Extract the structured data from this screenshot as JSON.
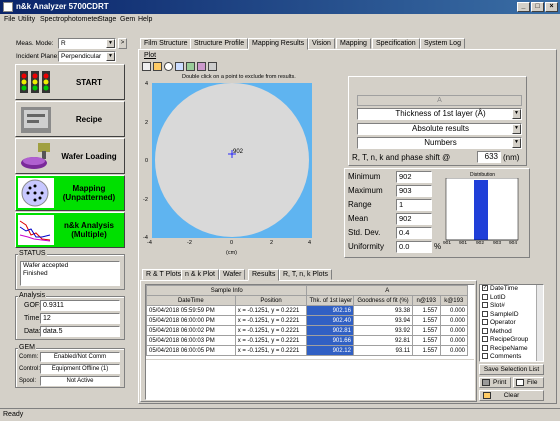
{
  "window": {
    "title": "n&k Analyzer 5700CDRT"
  },
  "menu": [
    "File",
    "Utility",
    "Spectrophotometer",
    "Stage",
    "Gem",
    "Help"
  ],
  "left": {
    "meas_mode_label": "Meas. Mode:",
    "meas_mode_value": "R",
    "incident_label": "Incident Plane:",
    "incident_value": "Perpendicular",
    "buttons": {
      "start": "START",
      "recipe": "Recipe",
      "wafer": "Wafer Loading",
      "mapping": "Mapping (Unpatterned)",
      "nk": "n&k Analysis (Multiple)"
    },
    "status_title": "STATUS",
    "status_lines": [
      "Wafer accepted",
      "Finished"
    ],
    "analysis_title": "Analysis",
    "gof_label": "GOF:",
    "gof_value": "0.9311",
    "time_label": "Time:",
    "time_value": "12",
    "data_label": "Data:",
    "data_value": "data.5",
    "gem_title": "GEM",
    "comm_label": "Comm:",
    "comm_value": "Enabled/Not Comm",
    "control_label": "Control:",
    "control_value": "Equipment Offline (1)",
    "spool_label": "Spool:",
    "spool_value": "Not Active"
  },
  "tabs": [
    "Film Structure",
    "Structure Profile",
    "Mapping Results",
    "Vision",
    "Mapping",
    "Specification",
    "System Log"
  ],
  "active_tab": "Mapping Results",
  "plot_label": "Plot",
  "map": {
    "hint": "Double click on a point to exclude from results.",
    "point_label": "902",
    "x_unit": "(cm)",
    "ticks": [
      "-4",
      "-2",
      "0",
      "2",
      "4"
    ],
    "yticks": [
      "4",
      "2",
      "0",
      "-2",
      "-4"
    ],
    "wafer_color": "#d9d9d9",
    "bg": "#5fb4f0"
  },
  "right": {
    "dd_a": "A",
    "dd_layer": "Thickness of 1st layer (Å)",
    "dd_results": "Absolute results",
    "dd_numbers": "Numbers",
    "phase_label": "R, T, n, k and phase shift @",
    "phase_value": "633",
    "phase_unit": "(nm)"
  },
  "stats": [
    {
      "label": "Minimum",
      "value": "902"
    },
    {
      "label": "Maximum",
      "value": "903"
    },
    {
      "label": "Range",
      "value": "1"
    },
    {
      "label": "Mean",
      "value": "902"
    },
    {
      "label": "Std. Dev.",
      "value": "0.4"
    },
    {
      "label": "Uniformity",
      "value": "0.0",
      "unit": "%"
    }
  ],
  "distribution": {
    "title": "Distribution",
    "xticks": [
      "901",
      "901",
      "902",
      "903",
      "904"
    ],
    "bar_color": "#1f3fd8"
  },
  "bottom_tabs": [
    "R & T Plots",
    "n & k Plot",
    "Wafer",
    "Results",
    "R, T, n, k Plots"
  ],
  "table": {
    "group_headers": {
      "sample": "Sample Info",
      "a": "A"
    },
    "headers": [
      "DateTime",
      "Position",
      "Thk. of 1st layer",
      "Goodness of fit (%)",
      "n@193",
      "k@193"
    ],
    "rows": [
      [
        "05/04/2018 05:59:59 PM",
        "x = -0.1251,  y = 0.2221",
        "902.16",
        "93.38",
        "1.557",
        "0.000"
      ],
      [
        "05/04/2018 06:00:00 PM",
        "x = -0.1251,  y = 0.2221",
        "902.40",
        "93.94",
        "1.557",
        "0.000"
      ],
      [
        "05/04/2018 06:00:02 PM",
        "x = -0.1251,  y = 0.2221",
        "902.81",
        "93.92",
        "1.557",
        "0.000"
      ],
      [
        "05/04/2018 06:00:03 PM",
        "x = -0.1251,  y = 0.2221",
        "901.66",
        "92.81",
        "1.557",
        "0.000"
      ],
      [
        "05/04/2018 06:00:05 PM",
        "x = -0.1251,  y = 0.2221",
        "902.12",
        "93.11",
        "1.557",
        "0.000"
      ]
    ]
  },
  "selection": {
    "items": [
      {
        "label": "DateTime",
        "checked": true
      },
      {
        "label": "LotID",
        "checked": false
      },
      {
        "label": "Slot#",
        "checked": false
      },
      {
        "label": "SampleID",
        "checked": false
      },
      {
        "label": "Operator",
        "checked": false
      },
      {
        "label": "Method",
        "checked": false
      },
      {
        "label": "RecipeGroup",
        "checked": false
      },
      {
        "label": "RecipeName",
        "checked": false
      },
      {
        "label": "Comments",
        "checked": false
      }
    ],
    "save_label": "Save Selection List",
    "print_label": "Print",
    "file_label": "File",
    "clear_label": "Clear"
  },
  "statusbar": "Ready"
}
